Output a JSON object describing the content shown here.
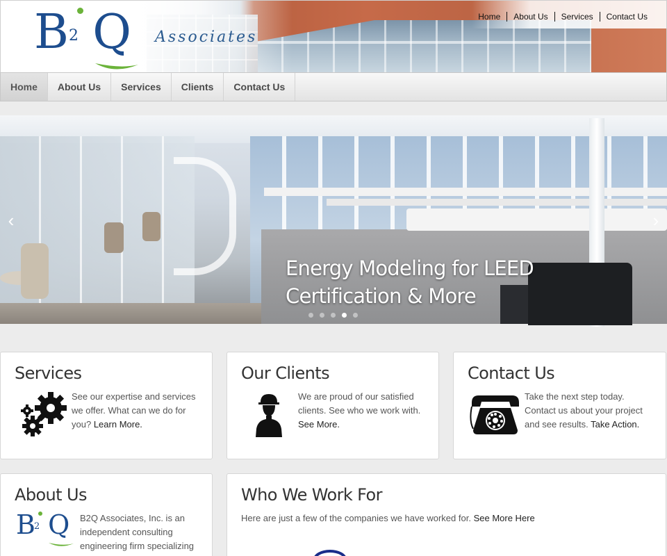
{
  "header": {
    "logo_text": "B2Q",
    "logo_tagline": "Associates",
    "top_links": [
      "Home",
      "About Us",
      "Services",
      "Contact Us"
    ]
  },
  "nav": {
    "items": [
      {
        "label": "Home",
        "active": true
      },
      {
        "label": "About Us",
        "active": false
      },
      {
        "label": "Services",
        "active": false
      },
      {
        "label": "Clients",
        "active": false
      },
      {
        "label": "Contact Us",
        "active": false
      }
    ]
  },
  "slider": {
    "caption_line1": "Energy Modeling for LEED",
    "caption_line2": "Certification & More",
    "prev_glyph": "‹",
    "next_glyph": "›",
    "slide_count": 5,
    "active_slide": 4
  },
  "boxes": {
    "services": {
      "title": "Services",
      "text": "See our expertise and services we offer. What can we do for you?",
      "link": "Learn More.",
      "icon": "gears-icon"
    },
    "clients": {
      "title": "Our Clients",
      "text": "We are proud of our satisfied clients. See who we work with.",
      "link": "See More.",
      "icon": "hardhat-worker-icon"
    },
    "contact": {
      "title": "Contact Us",
      "text": "Take the next step today. Contact us about your project and see results.",
      "link": "Take Action.",
      "icon": "rotary-phone-icon"
    },
    "about": {
      "title": "About Us",
      "text": "B2Q Associates, Inc. is an independent consulting engineering firm specializing",
      "icon": "b2q-logo-icon"
    },
    "who": {
      "title": "Who We Work For",
      "text": "Here are just a few of the companies we have worked for.",
      "link": "See More Here"
    }
  },
  "colors": {
    "brand_blue": "#1d4d8e",
    "brand_green": "#6bb33a",
    "page_bg": "#ececec"
  }
}
